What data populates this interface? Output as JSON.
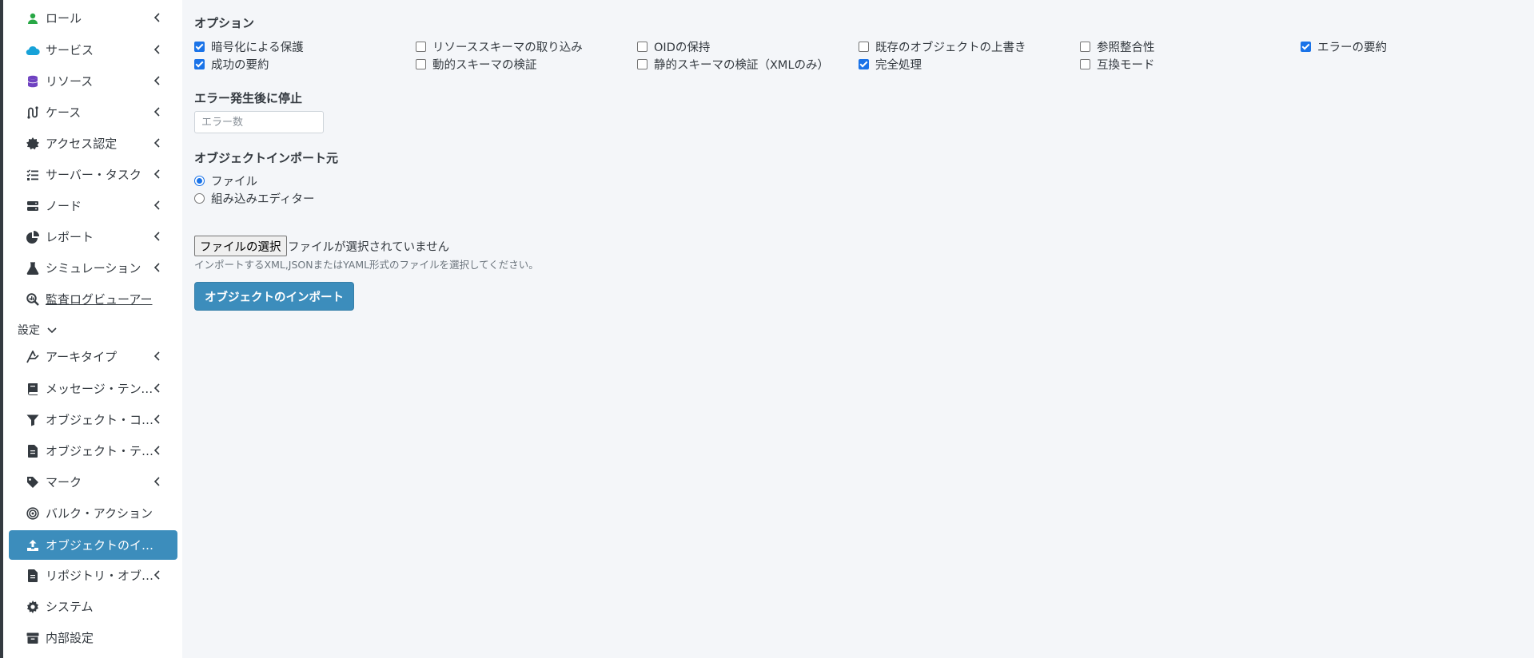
{
  "sidebar": {
    "items": [
      {
        "label": "ロール",
        "icon": "role-icon",
        "chevron": true
      },
      {
        "label": "サービス",
        "icon": "cloud-icon",
        "chevron": true
      },
      {
        "label": "リソース",
        "icon": "database-icon",
        "chevron": true
      },
      {
        "label": "ケース",
        "icon": "route-icon",
        "chevron": true
      },
      {
        "label": "アクセス認定",
        "icon": "certificate-icon",
        "chevron": true
      },
      {
        "label": "サーバー・タスク",
        "icon": "tasks-icon",
        "chevron": true
      },
      {
        "label": "ノード",
        "icon": "server-icon",
        "chevron": true
      },
      {
        "label": "レポート",
        "icon": "pie-chart-icon",
        "chevron": true
      },
      {
        "label": "シミュレーション",
        "icon": "flask-icon",
        "chevron": true
      },
      {
        "label": "監査ログビューアー",
        "icon": "search-chart-icon",
        "chevron": false
      }
    ],
    "settings_header": "設定",
    "settings_items": [
      {
        "label": "アーキタイプ",
        "icon": "archetype-icon",
        "chevron": true
      },
      {
        "label": "メッセージ・テンプレート",
        "icon": "book-icon",
        "chevron": true
      },
      {
        "label": "オブジェクト・コレクション",
        "icon": "filter-icon",
        "chevron": true
      },
      {
        "label": "オブジェクト・テンプレート",
        "icon": "file-icon",
        "chevron": true
      },
      {
        "label": "マーク",
        "icon": "tag-icon",
        "chevron": true
      },
      {
        "label": "バルク・アクション",
        "icon": "bullseye-icon",
        "chevron": false
      },
      {
        "label": "オブジェクトのインポート",
        "icon": "upload-icon",
        "chevron": false,
        "active": true
      },
      {
        "label": "リポジトリ・オブジェクト",
        "icon": "file-icon",
        "chevron": true
      },
      {
        "label": "システム",
        "icon": "gear-icon",
        "chevron": false
      },
      {
        "label": "内部設定",
        "icon": "archive-icon",
        "chevron": false
      }
    ]
  },
  "options": {
    "title": "オプション",
    "checkboxes": [
      {
        "label": "暗号化による保護",
        "checked": true
      },
      {
        "label": "リソーススキーマの取り込み",
        "checked": false
      },
      {
        "label": "OIDの保持",
        "checked": false
      },
      {
        "label": "既存のオブジェクトの上書き",
        "checked": false
      },
      {
        "label": "参照整合性",
        "checked": false
      },
      {
        "label": "エラーの要約",
        "checked": true
      },
      {
        "label": "成功の要約",
        "checked": true
      },
      {
        "label": "動的スキーマの検証",
        "checked": false
      },
      {
        "label": "静的スキーマの検証（XMLのみ）",
        "checked": false
      },
      {
        "label": "完全処理",
        "checked": true
      },
      {
        "label": "互換モード",
        "checked": false
      }
    ]
  },
  "stop_after_errors": {
    "title": "エラー発生後に停止",
    "placeholder": "エラー数",
    "value": ""
  },
  "import_source": {
    "title": "オブジェクトインポート元",
    "options": [
      {
        "label": "ファイル",
        "selected": true
      },
      {
        "label": "組み込みエディター",
        "selected": false
      }
    ]
  },
  "file_input": {
    "button_label": "ファイルの選択",
    "status": "ファイルが選択されていません",
    "help": "インポートするXML,JSONまたはYAML形式のファイルを選択してください。"
  },
  "import_button": "オブジェクトのインポート",
  "colors": {
    "accent": "#3c8dbc",
    "checkbox": "#1a73e8",
    "sidebar_bg": "#ffffff",
    "content_bg": "#f4f6f9"
  }
}
